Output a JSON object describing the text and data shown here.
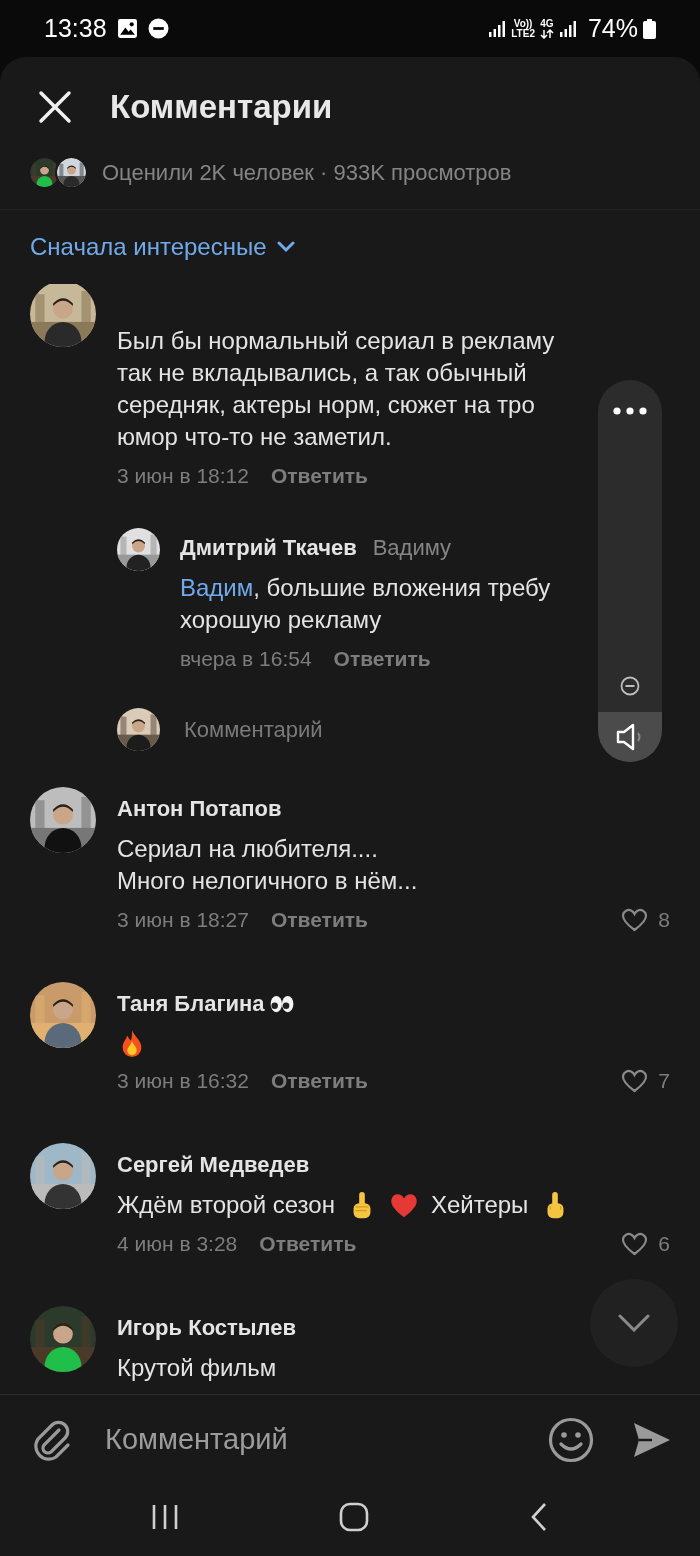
{
  "status_bar": {
    "time": "13:38",
    "volte": "Vo))",
    "lte": "LTE2",
    "network": "4G",
    "battery": "74%"
  },
  "header": {
    "title": "Комментарии"
  },
  "stats": {
    "text": "Оценили 2K человек · 933K просмотров"
  },
  "sort": {
    "label": "Сначала интересные"
  },
  "comments": [
    {
      "kind": "comment",
      "body": [
        {
          "kind": "text",
          "text": "Был бы нормальный сериал в рекламу\nтак не вкладывались, а так обычный\nсередняк, актеры норм, сюжет на тро\nюмор что-то не заметил."
        }
      ],
      "date": "3 июн в 18:12",
      "reply": "Ответить"
    },
    {
      "kind": "reply",
      "author": "Дмитрий Ткачев",
      "addressee": "Вадиму",
      "body": [
        {
          "kind": "mention",
          "text": "Вадим"
        },
        {
          "kind": "text",
          "text": ", большие вложения требу\nхорошую рекламу"
        }
      ],
      "date": "вчера в 16:54",
      "reply": "Ответить"
    },
    {
      "kind": "reply_input",
      "placeholder": "Комментарий"
    },
    {
      "kind": "comment",
      "author": "Антон Потапов",
      "body": [
        {
          "kind": "text",
          "text": "Сериал на любителя....\nМного нелогичного в нём..."
        }
      ],
      "date": "3 июн в 18:27",
      "reply": "Ответить",
      "likes": "8"
    },
    {
      "kind": "comment",
      "author": "Таня Благина",
      "author_emoji": [
        {
          "kind": "eyes"
        }
      ],
      "body": [
        {
          "kind": "fire"
        }
      ],
      "date": "3 июн в 16:32",
      "reply": "Ответить",
      "likes": "7"
    },
    {
      "kind": "comment",
      "author": "Сергей Медведев",
      "body": [
        {
          "kind": "text",
          "text": "Ждём второй сезон"
        },
        {
          "kind": "point_up"
        },
        {
          "kind": "heart"
        },
        {
          "kind": "text",
          "text": "Хейтеры"
        },
        {
          "kind": "finger"
        }
      ],
      "date": "4 июн в 3:28",
      "reply": "Ответить",
      "likes": "6"
    },
    {
      "kind": "comment",
      "author": "Игорь Костылев",
      "body": [
        {
          "kind": "text",
          "text": "Крутой фильм"
        }
      ]
    }
  ],
  "volume": {
    "level": 0.13
  },
  "composer": {
    "placeholder": "Комментарий"
  }
}
